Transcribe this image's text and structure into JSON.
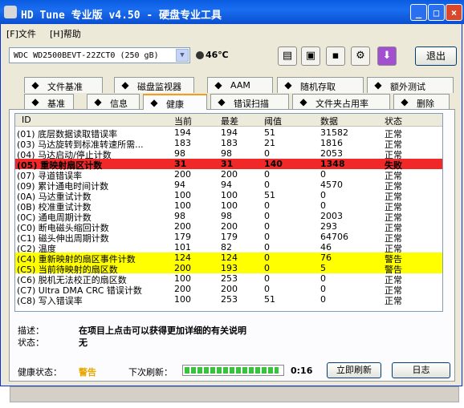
{
  "window": {
    "title": "HD Tune 专业版 v4.50 - 硬盘专业工具",
    "minimize": "_",
    "maximize": "□",
    "close": "×"
  },
  "menu": [
    "[F]文件",
    "[H]帮助"
  ],
  "toolbar": {
    "drive": "WDC WD2500BEVT-22ZCT0    (250 gB)",
    "temperature": "46℃",
    "exit_label": "退出",
    "icons": [
      "copy-text-icon",
      "copy-screen-icon",
      "save-icon",
      "options-icon",
      "download-icon"
    ]
  },
  "tabs_top": [
    {
      "label": "文件基准",
      "icon": "file-benchmark-icon"
    },
    {
      "label": "磁盘监视器",
      "icon": "disk-monitor-icon"
    },
    {
      "label": "AAM",
      "icon": "speaker-icon"
    },
    {
      "label": "随机存取",
      "icon": "random-access-icon"
    },
    {
      "label": "额外测试",
      "icon": "extra-tests-icon"
    }
  ],
  "tabs_bottom": [
    {
      "label": "基准",
      "icon": "benchmark-icon"
    },
    {
      "label": "信息",
      "icon": "info-icon"
    },
    {
      "label": "健康",
      "icon": "health-icon",
      "active": true
    },
    {
      "label": "错误扫描",
      "icon": "error-scan-icon"
    },
    {
      "label": "文件夹占用率",
      "icon": "folder-icon"
    },
    {
      "label": "删除",
      "icon": "erase-icon"
    }
  ],
  "table": {
    "columns": [
      "ID",
      "当前",
      "最差",
      "阈值",
      "数据",
      "状态"
    ],
    "rows": [
      {
        "id": "(01) 底层数据读取错误率",
        "cur": "194",
        "worst": "194",
        "thr": "51",
        "data": "31582",
        "status": "正常",
        "state": "ok"
      },
      {
        "id": "(03) 马达旋转到标准转速所需...",
        "cur": "183",
        "worst": "183",
        "thr": "21",
        "data": "1816",
        "status": "正常",
        "state": "ok"
      },
      {
        "id": "(04) 马达启动/停止计数",
        "cur": "98",
        "worst": "98",
        "thr": "0",
        "data": "2053",
        "status": "正常",
        "state": "ok"
      },
      {
        "id": "(05) 重映射扇区计数",
        "cur": "31",
        "worst": "31",
        "thr": "140",
        "data": "1348",
        "status": "失败",
        "state": "fail"
      },
      {
        "id": "(07) 寻道错误率",
        "cur": "200",
        "worst": "200",
        "thr": "0",
        "data": "0",
        "status": "正常",
        "state": "ok"
      },
      {
        "id": "(09) 累计通电时间计数",
        "cur": "94",
        "worst": "94",
        "thr": "0",
        "data": "4570",
        "status": "正常",
        "state": "ok"
      },
      {
        "id": "(0A) 马达重试计数",
        "cur": "100",
        "worst": "100",
        "thr": "51",
        "data": "0",
        "status": "正常",
        "state": "ok"
      },
      {
        "id": "(0B) 校准重试计数",
        "cur": "100",
        "worst": "100",
        "thr": "0",
        "data": "0",
        "status": "正常",
        "state": "ok"
      },
      {
        "id": "(0C) 通电周期计数",
        "cur": "98",
        "worst": "98",
        "thr": "0",
        "data": "2003",
        "status": "正常",
        "state": "ok"
      },
      {
        "id": "(C0) 断电磁头缩回计数",
        "cur": "200",
        "worst": "200",
        "thr": "0",
        "data": "293",
        "status": "正常",
        "state": "ok"
      },
      {
        "id": "(C1) 磁头伸出周期计数",
        "cur": "179",
        "worst": "179",
        "thr": "0",
        "data": "64706",
        "status": "正常",
        "state": "ok"
      },
      {
        "id": "(C2) 温度",
        "cur": "101",
        "worst": "82",
        "thr": "0",
        "data": "46",
        "status": "正常",
        "state": "ok"
      },
      {
        "id": "(C4) 重新映射的扇区事件计数",
        "cur": "124",
        "worst": "124",
        "thr": "0",
        "data": "76",
        "status": "警告",
        "state": "warn"
      },
      {
        "id": "(C5) 当前待映射的扇区数",
        "cur": "200",
        "worst": "193",
        "thr": "0",
        "data": "5",
        "status": "警告",
        "state": "warn"
      },
      {
        "id": "(C6) 脱机无法校正的扇区数",
        "cur": "100",
        "worst": "253",
        "thr": "0",
        "data": "0",
        "status": "正常",
        "state": "ok"
      },
      {
        "id": "(C7) Ultra DMA CRC 错误计数",
        "cur": "200",
        "worst": "200",
        "thr": "0",
        "data": "0",
        "status": "正常",
        "state": "ok"
      },
      {
        "id": "(C8) 写入错误率",
        "cur": "100",
        "worst": "253",
        "thr": "51",
        "data": "0",
        "status": "正常",
        "state": "ok"
      }
    ]
  },
  "details": {
    "desc_label": "描述：",
    "desc_value": "在项目上点击可以获得更加详细的有关说明",
    "state_label": "状态：",
    "state_value": "无"
  },
  "footer": {
    "health_label": "健康状态：",
    "health_value": "警告",
    "next_refresh_label": "下次刷新：",
    "progress": 0.97,
    "timer": "0:16",
    "refresh_button": "立即刷新",
    "log_button": "日志"
  },
  "colors": {
    "fail_row": "#f02828",
    "warn_row": "#ffff00",
    "titlebar": "#0a5be0"
  }
}
